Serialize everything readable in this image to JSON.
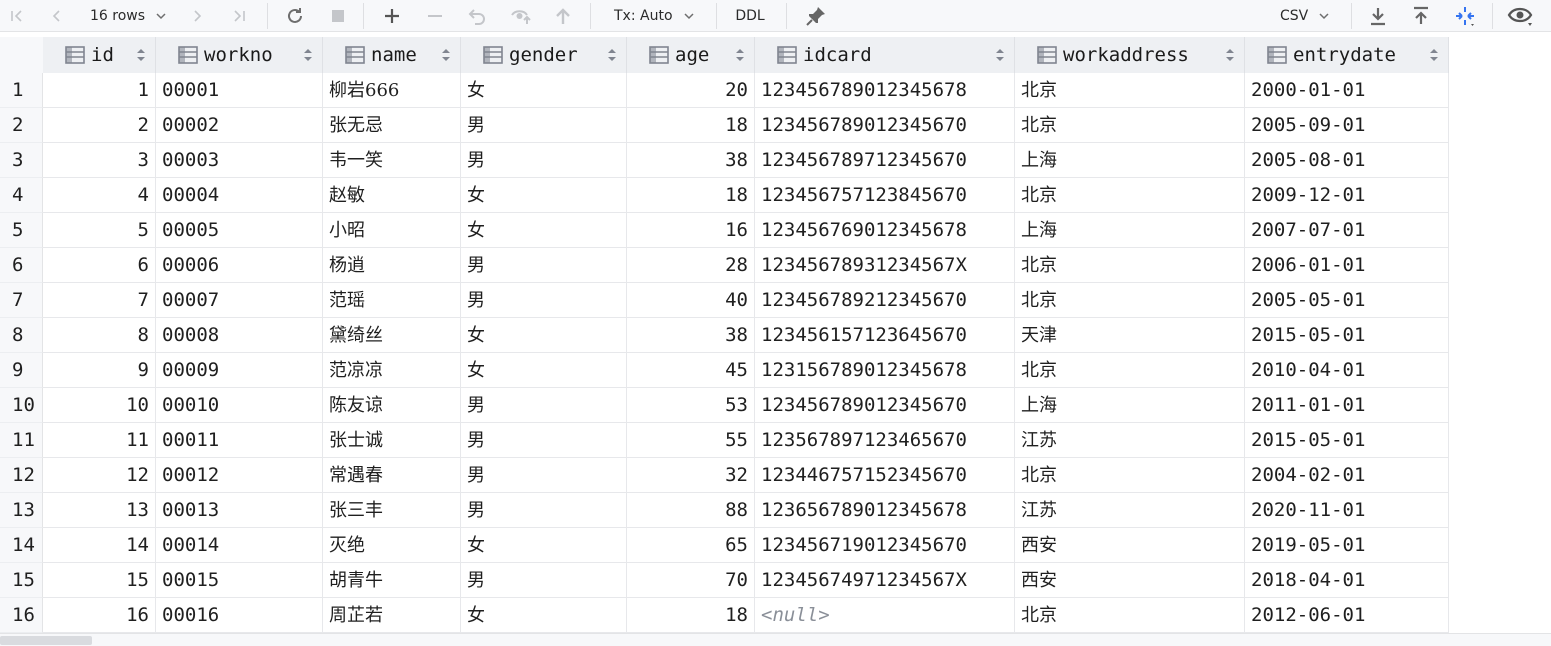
{
  "toolbar": {
    "rows_label": "16 rows",
    "tx_label": "Tx: Auto",
    "ddl_label": "DDL",
    "export_format": "CSV"
  },
  "columns": [
    {
      "key": "id",
      "label": "id"
    },
    {
      "key": "workno",
      "label": "workno"
    },
    {
      "key": "name",
      "label": "name"
    },
    {
      "key": "gender",
      "label": "gender"
    },
    {
      "key": "age",
      "label": "age"
    },
    {
      "key": "idcard",
      "label": "idcard"
    },
    {
      "key": "workaddress",
      "label": "workaddress"
    },
    {
      "key": "entrydate",
      "label": "entrydate"
    }
  ],
  "rows": [
    {
      "n": "1",
      "id": "1",
      "workno": "00001",
      "name": "柳岩666",
      "gender": "女",
      "age": "20",
      "idcard": "123456789012345678",
      "workaddress": "北京",
      "entrydate": "2000-01-01"
    },
    {
      "n": "2",
      "id": "2",
      "workno": "00002",
      "name": "张无忌",
      "gender": "男",
      "age": "18",
      "idcard": "123456789012345670",
      "workaddress": "北京",
      "entrydate": "2005-09-01"
    },
    {
      "n": "3",
      "id": "3",
      "workno": "00003",
      "name": "韦一笑",
      "gender": "男",
      "age": "38",
      "idcard": "123456789712345670",
      "workaddress": "上海",
      "entrydate": "2005-08-01"
    },
    {
      "n": "4",
      "id": "4",
      "workno": "00004",
      "name": "赵敏",
      "gender": "女",
      "age": "18",
      "idcard": "123456757123845670",
      "workaddress": "北京",
      "entrydate": "2009-12-01"
    },
    {
      "n": "5",
      "id": "5",
      "workno": "00005",
      "name": "小昭",
      "gender": "女",
      "age": "16",
      "idcard": "123456769012345678",
      "workaddress": "上海",
      "entrydate": "2007-07-01"
    },
    {
      "n": "6",
      "id": "6",
      "workno": "00006",
      "name": "杨逍",
      "gender": "男",
      "age": "28",
      "idcard": "12345678931234567X",
      "workaddress": "北京",
      "entrydate": "2006-01-01"
    },
    {
      "n": "7",
      "id": "7",
      "workno": "00007",
      "name": "范瑶",
      "gender": "男",
      "age": "40",
      "idcard": "123456789212345670",
      "workaddress": "北京",
      "entrydate": "2005-05-01"
    },
    {
      "n": "8",
      "id": "8",
      "workno": "00008",
      "name": "黛绮丝",
      "gender": "女",
      "age": "38",
      "idcard": "123456157123645670",
      "workaddress": "天津",
      "entrydate": "2015-05-01"
    },
    {
      "n": "9",
      "id": "9",
      "workno": "00009",
      "name": "范凉凉",
      "gender": "女",
      "age": "45",
      "idcard": "123156789012345678",
      "workaddress": "北京",
      "entrydate": "2010-04-01"
    },
    {
      "n": "10",
      "id": "10",
      "workno": "00010",
      "name": "陈友谅",
      "gender": "男",
      "age": "53",
      "idcard": "123456789012345670",
      "workaddress": "上海",
      "entrydate": "2011-01-01"
    },
    {
      "n": "11",
      "id": "11",
      "workno": "00011",
      "name": "张士诚",
      "gender": "男",
      "age": "55",
      "idcard": "123567897123465670",
      "workaddress": "江苏",
      "entrydate": "2015-05-01"
    },
    {
      "n": "12",
      "id": "12",
      "workno": "00012",
      "name": "常遇春",
      "gender": "男",
      "age": "32",
      "idcard": "123446757152345670",
      "workaddress": "北京",
      "entrydate": "2004-02-01"
    },
    {
      "n": "13",
      "id": "13",
      "workno": "00013",
      "name": "张三丰",
      "gender": "男",
      "age": "88",
      "idcard": "123656789012345678",
      "workaddress": "江苏",
      "entrydate": "2020-11-01"
    },
    {
      "n": "14",
      "id": "14",
      "workno": "00014",
      "name": "灭绝",
      "gender": "女",
      "age": "65",
      "idcard": "123456719012345670",
      "workaddress": "西安",
      "entrydate": "2019-05-01"
    },
    {
      "n": "15",
      "id": "15",
      "workno": "00015",
      "name": "胡青牛",
      "gender": "男",
      "age": "70",
      "idcard": "12345674971234567X",
      "workaddress": "西安",
      "entrydate": "2018-04-01"
    },
    {
      "n": "16",
      "id": "16",
      "workno": "00016",
      "name": "周芷若",
      "gender": "女",
      "age": "18",
      "idcard": "<null>",
      "workaddress": "北京",
      "entrydate": "2012-06-01"
    }
  ]
}
